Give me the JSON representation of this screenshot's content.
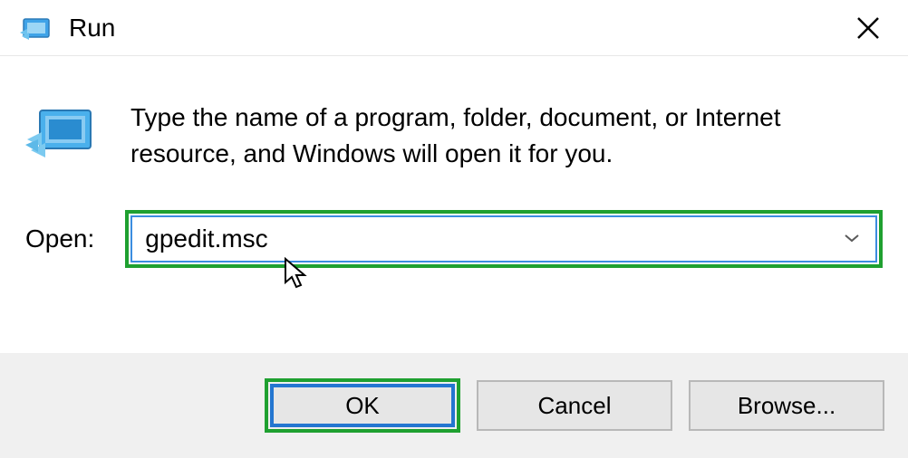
{
  "window": {
    "title": "Run"
  },
  "description": "Type the name of a program, folder, document, or Internet resource, and Windows will open it for you.",
  "open": {
    "label": "Open:",
    "value": "gpedit.msc"
  },
  "buttons": {
    "ok": "OK",
    "cancel": "Cancel",
    "browse": "Browse..."
  }
}
